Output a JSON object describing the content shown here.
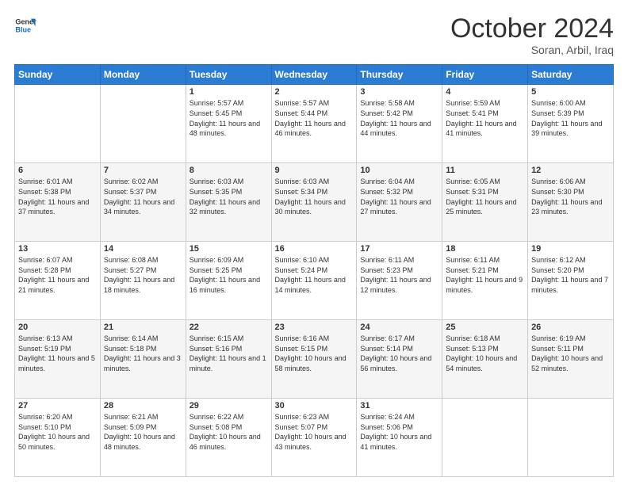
{
  "header": {
    "logo_line1": "General",
    "logo_line2": "Blue",
    "month": "October 2024",
    "location": "Soran, Arbil, Iraq"
  },
  "weekdays": [
    "Sunday",
    "Monday",
    "Tuesday",
    "Wednesday",
    "Thursday",
    "Friday",
    "Saturday"
  ],
  "weeks": [
    [
      {
        "day": "",
        "info": ""
      },
      {
        "day": "",
        "info": ""
      },
      {
        "day": "1",
        "info": "Sunrise: 5:57 AM\nSunset: 5:45 PM\nDaylight: 11 hours and 48 minutes."
      },
      {
        "day": "2",
        "info": "Sunrise: 5:57 AM\nSunset: 5:44 PM\nDaylight: 11 hours and 46 minutes."
      },
      {
        "day": "3",
        "info": "Sunrise: 5:58 AM\nSunset: 5:42 PM\nDaylight: 11 hours and 44 minutes."
      },
      {
        "day": "4",
        "info": "Sunrise: 5:59 AM\nSunset: 5:41 PM\nDaylight: 11 hours and 41 minutes."
      },
      {
        "day": "5",
        "info": "Sunrise: 6:00 AM\nSunset: 5:39 PM\nDaylight: 11 hours and 39 minutes."
      }
    ],
    [
      {
        "day": "6",
        "info": "Sunrise: 6:01 AM\nSunset: 5:38 PM\nDaylight: 11 hours and 37 minutes."
      },
      {
        "day": "7",
        "info": "Sunrise: 6:02 AM\nSunset: 5:37 PM\nDaylight: 11 hours and 34 minutes."
      },
      {
        "day": "8",
        "info": "Sunrise: 6:03 AM\nSunset: 5:35 PM\nDaylight: 11 hours and 32 minutes."
      },
      {
        "day": "9",
        "info": "Sunrise: 6:03 AM\nSunset: 5:34 PM\nDaylight: 11 hours and 30 minutes."
      },
      {
        "day": "10",
        "info": "Sunrise: 6:04 AM\nSunset: 5:32 PM\nDaylight: 11 hours and 27 minutes."
      },
      {
        "day": "11",
        "info": "Sunrise: 6:05 AM\nSunset: 5:31 PM\nDaylight: 11 hours and 25 minutes."
      },
      {
        "day": "12",
        "info": "Sunrise: 6:06 AM\nSunset: 5:30 PM\nDaylight: 11 hours and 23 minutes."
      }
    ],
    [
      {
        "day": "13",
        "info": "Sunrise: 6:07 AM\nSunset: 5:28 PM\nDaylight: 11 hours and 21 minutes."
      },
      {
        "day": "14",
        "info": "Sunrise: 6:08 AM\nSunset: 5:27 PM\nDaylight: 11 hours and 18 minutes."
      },
      {
        "day": "15",
        "info": "Sunrise: 6:09 AM\nSunset: 5:25 PM\nDaylight: 11 hours and 16 minutes."
      },
      {
        "day": "16",
        "info": "Sunrise: 6:10 AM\nSunset: 5:24 PM\nDaylight: 11 hours and 14 minutes."
      },
      {
        "day": "17",
        "info": "Sunrise: 6:11 AM\nSunset: 5:23 PM\nDaylight: 11 hours and 12 minutes."
      },
      {
        "day": "18",
        "info": "Sunrise: 6:11 AM\nSunset: 5:21 PM\nDaylight: 11 hours and 9 minutes."
      },
      {
        "day": "19",
        "info": "Sunrise: 6:12 AM\nSunset: 5:20 PM\nDaylight: 11 hours and 7 minutes."
      }
    ],
    [
      {
        "day": "20",
        "info": "Sunrise: 6:13 AM\nSunset: 5:19 PM\nDaylight: 11 hours and 5 minutes."
      },
      {
        "day": "21",
        "info": "Sunrise: 6:14 AM\nSunset: 5:18 PM\nDaylight: 11 hours and 3 minutes."
      },
      {
        "day": "22",
        "info": "Sunrise: 6:15 AM\nSunset: 5:16 PM\nDaylight: 11 hours and 1 minute."
      },
      {
        "day": "23",
        "info": "Sunrise: 6:16 AM\nSunset: 5:15 PM\nDaylight: 10 hours and 58 minutes."
      },
      {
        "day": "24",
        "info": "Sunrise: 6:17 AM\nSunset: 5:14 PM\nDaylight: 10 hours and 56 minutes."
      },
      {
        "day": "25",
        "info": "Sunrise: 6:18 AM\nSunset: 5:13 PM\nDaylight: 10 hours and 54 minutes."
      },
      {
        "day": "26",
        "info": "Sunrise: 6:19 AM\nSunset: 5:11 PM\nDaylight: 10 hours and 52 minutes."
      }
    ],
    [
      {
        "day": "27",
        "info": "Sunrise: 6:20 AM\nSunset: 5:10 PM\nDaylight: 10 hours and 50 minutes."
      },
      {
        "day": "28",
        "info": "Sunrise: 6:21 AM\nSunset: 5:09 PM\nDaylight: 10 hours and 48 minutes."
      },
      {
        "day": "29",
        "info": "Sunrise: 6:22 AM\nSunset: 5:08 PM\nDaylight: 10 hours and 46 minutes."
      },
      {
        "day": "30",
        "info": "Sunrise: 6:23 AM\nSunset: 5:07 PM\nDaylight: 10 hours and 43 minutes."
      },
      {
        "day": "31",
        "info": "Sunrise: 6:24 AM\nSunset: 5:06 PM\nDaylight: 10 hours and 41 minutes."
      },
      {
        "day": "",
        "info": ""
      },
      {
        "day": "",
        "info": ""
      }
    ]
  ]
}
